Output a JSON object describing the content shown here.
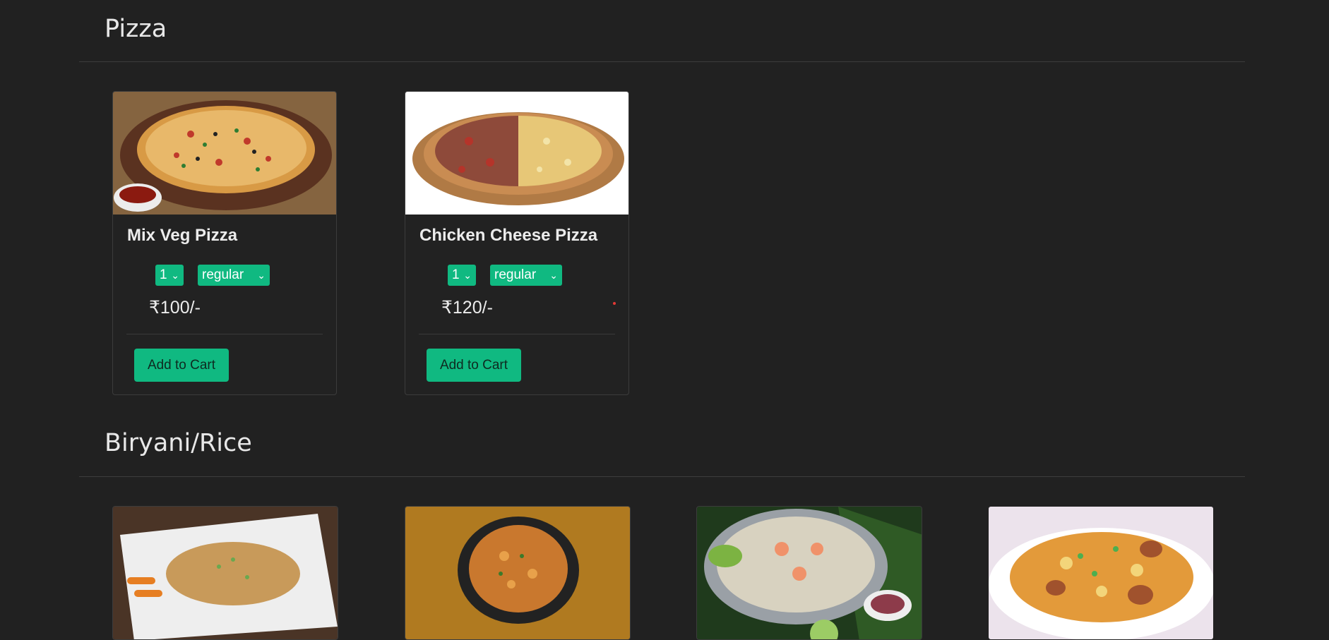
{
  "sections": [
    {
      "title": "Pizza",
      "items": [
        {
          "name": "Mix Veg Pizza",
          "qty": "1",
          "size": "regular",
          "price": "₹100/-",
          "button": "Add to Cart"
        },
        {
          "name": "Chicken Cheese Pizza",
          "qty": "1",
          "size": "regular",
          "price": "₹120/-",
          "button": "Add to Cart"
        }
      ]
    },
    {
      "title": "Biryani/Rice"
    }
  ],
  "colors": {
    "background": "#212121",
    "accent": "#10b981",
    "card_border": "#3c3c3c"
  }
}
